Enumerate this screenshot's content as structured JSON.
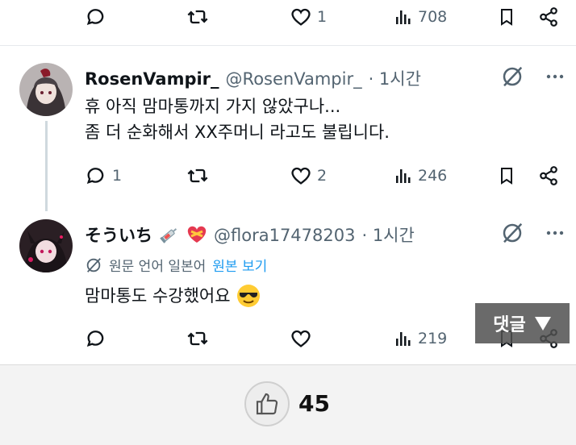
{
  "tweets": [
    {
      "stats": {
        "replies": "",
        "retweets": "",
        "likes": "1",
        "views": "708"
      }
    },
    {
      "display_name": "RosenVampir_",
      "handle": "@RosenVampir_",
      "time": "· 1시간",
      "text_lines": [
        "휴 아직 맘마통까지 가지 않았구나...",
        "좀 더 순화해서 XX주머니 라고도 불립니다."
      ],
      "stats": {
        "replies": "1",
        "retweets": "",
        "likes": "2",
        "views": "246"
      }
    },
    {
      "display_name": "そういち",
      "name_emojis": [
        "syringe-icon",
        "heart-ribbon-icon"
      ],
      "handle": "@flora17478203",
      "time": "· 1시간",
      "translation": {
        "label": "원문 언어 일본어",
        "link": "원본 보기"
      },
      "text": "맘마통도 수강했어요",
      "text_emoji": "sunglasses-face-icon",
      "stats": {
        "replies": "",
        "retweets": "",
        "likes": "",
        "views": "219"
      }
    }
  ],
  "overlay": {
    "comment_button_label": "댓글"
  },
  "footer": {
    "like_count": "45"
  },
  "colors": {
    "accent": "#1d9bf0",
    "icon_gray": "#536471"
  }
}
